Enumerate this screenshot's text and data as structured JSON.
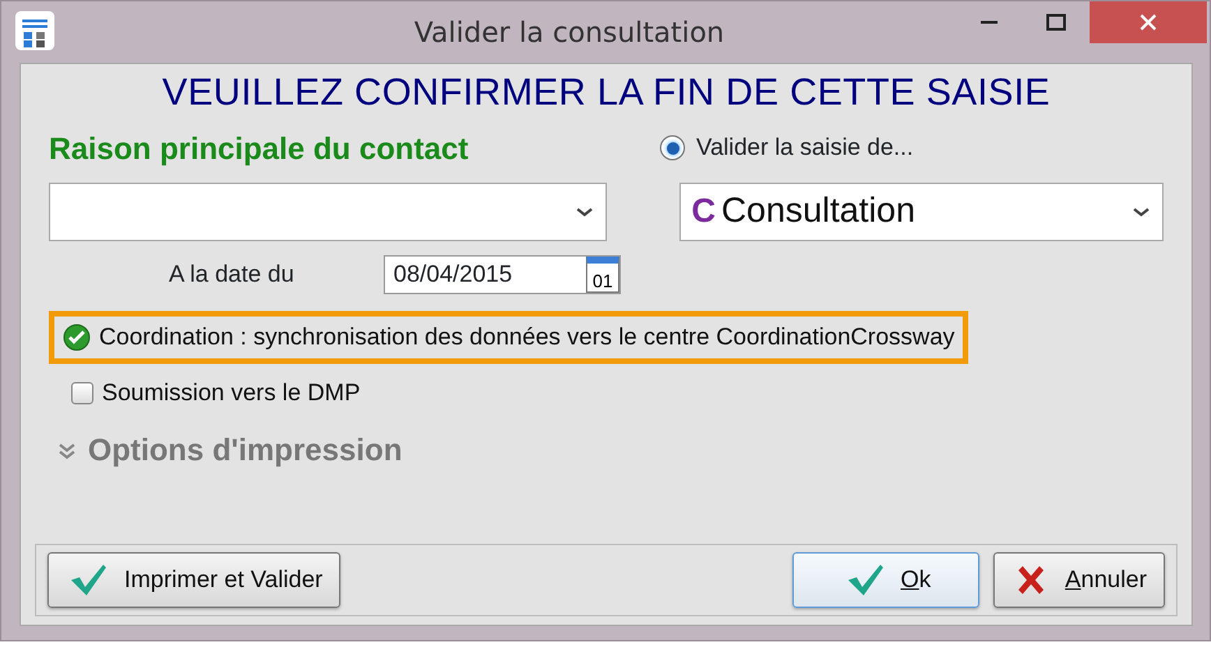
{
  "window": {
    "title": "Valider la consultation"
  },
  "heading": "VEUILLEZ CONFIRMER LA FIN DE CETTE SAISIE",
  "reason": {
    "label": "Raison principale du contact"
  },
  "validate_radio": {
    "label": "Valider la saisie de...",
    "selected": true
  },
  "entry_type": {
    "badge": "C",
    "value": "Consultation"
  },
  "date": {
    "label": "A la date du",
    "value": "08/04/2015",
    "calendar_day": "01"
  },
  "options": [
    {
      "kind": "status",
      "label": "Coordination : synchronisation des données vers le centre CoordinationCrossway",
      "checked": true,
      "highlighted": true
    },
    {
      "kind": "checkbox",
      "label": "Soumission vers le DMP",
      "checked": false,
      "highlighted": false
    }
  ],
  "print_options": {
    "label": "Options d'impression",
    "expanded": false
  },
  "buttons": [
    {
      "kind": "check",
      "label": "Imprimer et Valider",
      "mnemonic_first": false,
      "default": false
    },
    {
      "kind": "check",
      "label": "Ok",
      "mnemonic_first": true,
      "default": true
    },
    {
      "kind": "cross",
      "label": "Annuler",
      "mnemonic_first": true,
      "default": false
    }
  ]
}
